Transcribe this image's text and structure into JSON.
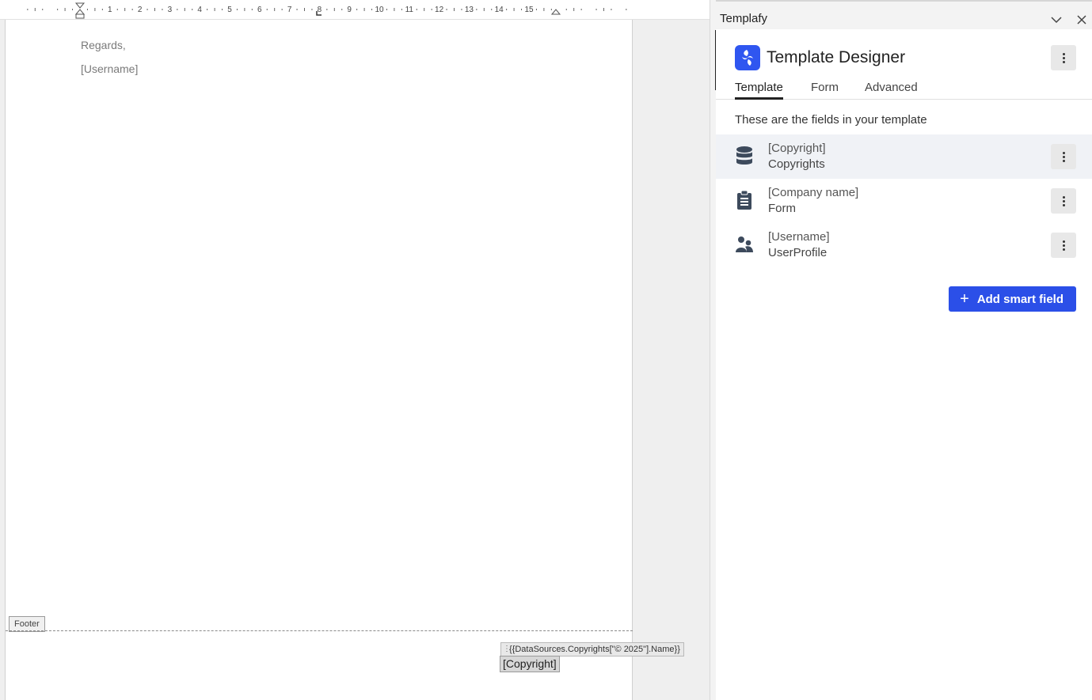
{
  "document": {
    "ruler_numbers": [
      "1",
      "2",
      "3",
      "4",
      "5",
      "6",
      "7",
      "8",
      "9",
      "10",
      "11",
      "12",
      "13",
      "14",
      "15"
    ],
    "lines": [
      "Regards,",
      "[Username]"
    ],
    "footer_label": "Footer",
    "content_control_tag": "{{DataSources.Copyrights[\"© 2025\"].Name}}",
    "content_control_value": "[Copyright]"
  },
  "panel": {
    "title": "Templafy",
    "brand_title": "Template Designer",
    "tabs": [
      {
        "label": "Template",
        "active": true
      },
      {
        "label": "Form",
        "active": false
      },
      {
        "label": "Advanced",
        "active": false
      }
    ],
    "section_title": "These are the fields in your template",
    "fields": [
      {
        "name": "[Copyright]",
        "source": "Copyrights",
        "icon": "database-icon",
        "selected": true
      },
      {
        "name": "[Company name]",
        "source": "Form",
        "icon": "clipboard-icon",
        "selected": false
      },
      {
        "name": "[Username]",
        "source": "UserProfile",
        "icon": "users-icon",
        "selected": false
      }
    ],
    "add_button_label": "Add smart field",
    "colors": {
      "accent": "#2b4fe8",
      "icon": "#3d4a5c"
    }
  }
}
